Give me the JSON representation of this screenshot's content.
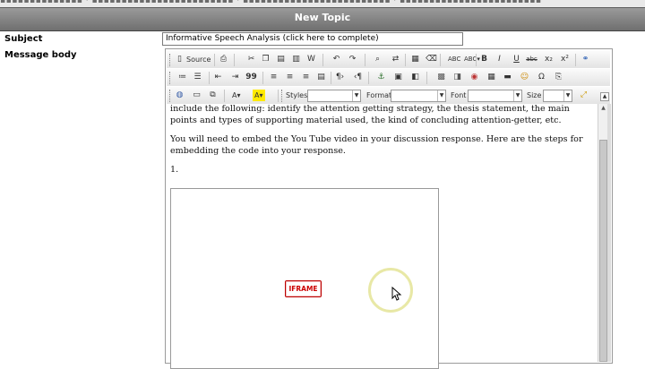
{
  "top_strip_text": "▪▪▪▪▪▪▪▪▪▪▪▪▪▪ · ▪▪▪▪▪▪▪▪▪▪▪▪▪▪▪▪▪▪▪▪▪▪▪▪ · ▪▪▪▪▪▪▪▪▪▪▪▪▪▪▪▪▪▪▪▪▪▪▪▪▪ · ▪▪▪▪▪▪▪▪▪▪▪▪▪▪▪▪▪▪▪▪▪▪▪▪",
  "header": {
    "title": "New Topic"
  },
  "form": {
    "subject_label": "Subject",
    "subject_value": "Informative Speech Analysis (click here to complete)",
    "body_label": "Message body"
  },
  "toolbar": {
    "source_label": "Source",
    "styles_label": "Styles",
    "format_label": "Format",
    "font_label": "Font",
    "size_label": "Size",
    "bold": "B",
    "italic": "I",
    "underline": "U",
    "strike": "abc",
    "subscript": "x₂",
    "superscript": "x²",
    "quote": "99"
  },
  "content": {
    "para1": "include the following:  identify the attention getting strategy, the thesis statement, the main points and types of supporting material used, the kind of concluding attention-getter, etc.",
    "para2": "You will need to embed the You Tube video in your discussion response.  Here are the steps for embedding the code into your response.",
    "para3": "1.",
    "iframe_label": "IFRAME"
  }
}
